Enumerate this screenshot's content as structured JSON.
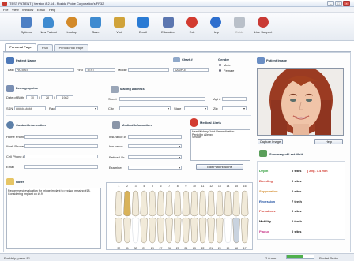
{
  "window": {
    "title": "TEST PATIENT | Version 8.2.14 - Florida Probe Corporation's FP32",
    "buttons": {
      "minimize": "–",
      "maximize": "□",
      "close": "×"
    }
  },
  "menu": [
    "File",
    "View",
    "Window",
    "Email",
    "Help"
  ],
  "toolbar": [
    {
      "label": "Options",
      "icon": "gear-icon",
      "color": "#4c7fc4"
    },
    {
      "label": "New Patient",
      "icon": "user-icon",
      "color": "#3f8bd0"
    },
    {
      "label": "Lookup",
      "icon": "search-icon",
      "color": "#d38a2a"
    },
    {
      "label": "Save",
      "icon": "save-icon",
      "color": "#3f8bd0"
    },
    {
      "label": "Visit",
      "icon": "visit-icon",
      "color": "#d0a33a"
    },
    {
      "label": "Email",
      "icon": "mail-icon",
      "color": "#2a7bd4"
    },
    {
      "label": "Education",
      "icon": "education-icon",
      "color": "#5b76b0"
    },
    {
      "label": "Exit",
      "icon": "exit-icon",
      "color": "#d23b30"
    },
    {
      "label": "Help",
      "icon": "help-icon",
      "color": "#2e6fce"
    },
    {
      "label": "Guide",
      "icon": "guide-icon",
      "color": "#b9c0c9"
    },
    {
      "label": "Live Support",
      "icon": "support-icon",
      "color": "#c93a35"
    }
  ],
  "tabs": [
    "Personal Page",
    "PSR",
    "Periodontal Page"
  ],
  "patient_name": {
    "title": "Patient Name",
    "last_label": "Last",
    "last_value": "PATIENT",
    "first_label": "First",
    "first_value": "TEST",
    "middle_label": "Middle",
    "middle_value": ""
  },
  "chart": {
    "title": "Chart #",
    "value": "SAMPLE"
  },
  "gender": {
    "title": "Gender",
    "male": "Male",
    "female": "Female",
    "selected": "Female"
  },
  "demographics": {
    "title": "Demographics",
    "dob_label": "Date of Birth",
    "dob_month": "10",
    "dob_day": "28",
    "dob_year": "1982",
    "ssn_label": "SSN",
    "ssn_value": "###-##-####",
    "race_label": "Race"
  },
  "mailing": {
    "title": "Mailing Address",
    "street_label": "Street",
    "apt_label": "Apt #",
    "city_label": "City",
    "state_label": "State",
    "zip_label": "Zip"
  },
  "contact": {
    "title": "Contact Information",
    "home_label": "Home Phone #",
    "work_label": "Work Phone #",
    "cell_label": "Cell Phone #",
    "email_label": "Email"
  },
  "medical": {
    "title": "Medical Information",
    "insurance_label": "Insurance #",
    "insurance2_label": "Insurance",
    "referral_label": "Referral Dr.",
    "examiner_label": "Examiner"
  },
  "alerts": {
    "title": "Medical Alerts",
    "items": [
      "Heart/Kidney/Joint Premedication",
      "Penicillin Allergy",
      "Smoker"
    ],
    "edit_button": "Edit Patient Alerts"
  },
  "notes": {
    "title": "Notes",
    "text": "Recommend evaluation for bridge implant to replace missing #18. Considering implant on #19."
  },
  "patient_image": {
    "title": "Patient Image",
    "capture_button": "Capture Image",
    "help_button": "Help"
  },
  "summary": {
    "title": "Summary of Last Visit",
    "rows": [
      {
        "label": "Depth",
        "value": "0 sites",
        "extra": "| Avg. 3.4 mm",
        "color": "#2f9d3a"
      },
      {
        "label": "Bleeding",
        "value": "0 sites",
        "extra": "",
        "color": "#d23b30"
      },
      {
        "label": "Suppuration",
        "value": "0 sites",
        "extra": "",
        "color": "#d38a2a"
      },
      {
        "label": "Recession",
        "value": "7 teeth",
        "extra": "",
        "color": "#1d4ea0"
      },
      {
        "label": "Furcations",
        "value": "0 sites",
        "extra": "",
        "color": "#d23b30"
      },
      {
        "label": "Mobility",
        "value": "0 teeth",
        "extra": "",
        "color": "#111111"
      },
      {
        "label": "Plaque",
        "value": "0 sites",
        "extra": "",
        "color": "#c93a8a"
      }
    ]
  },
  "tooth_numbers_top": [
    "1",
    "2",
    "3",
    "4",
    "5",
    "6",
    "7",
    "8",
    "9",
    "10",
    "11",
    "12",
    "13",
    "14",
    "15",
    "16"
  ],
  "tooth_numbers_bottom": [
    "32",
    "31",
    "30",
    "29",
    "28",
    "27",
    "26",
    "25",
    "24",
    "23",
    "22",
    "21",
    "20",
    "19",
    "18",
    "17"
  ],
  "status": {
    "help_hint": "For Help, press F1",
    "version": "2.0 mm",
    "product": "Pocket Probe",
    "progress": 0.6
  }
}
